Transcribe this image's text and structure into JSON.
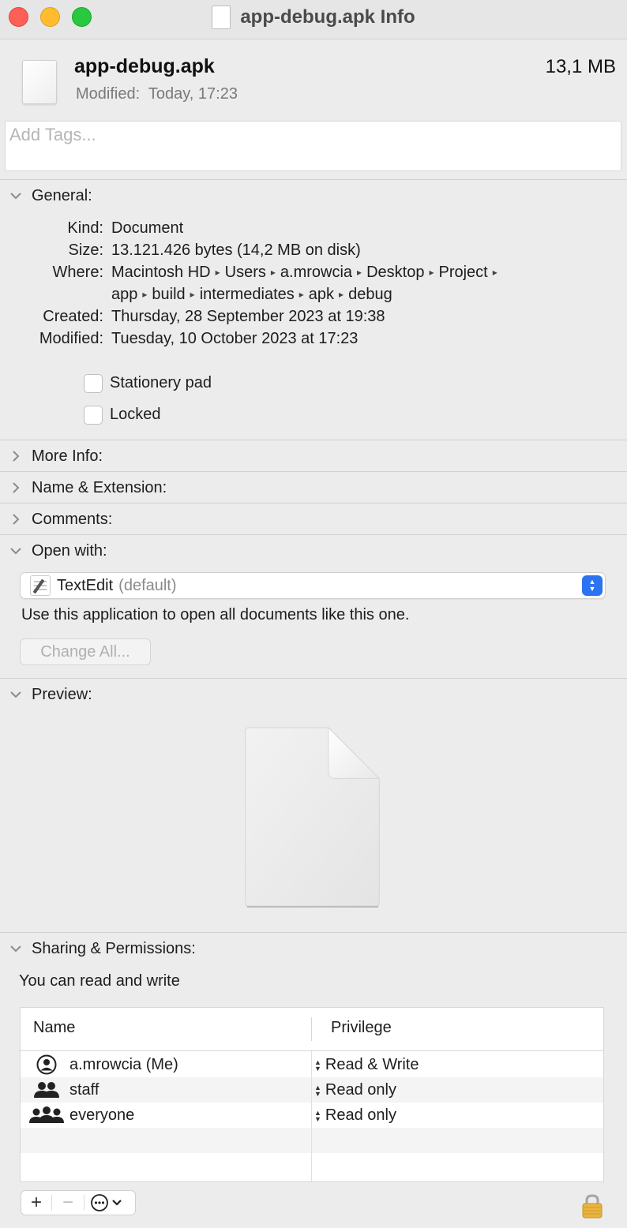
{
  "window": {
    "title": "app-debug.apk Info"
  },
  "header": {
    "file_name": "app-debug.apk",
    "file_size": "13,1 MB",
    "modified": "Modified:  Today, 17:23",
    "tags_placeholder": "Add Tags..."
  },
  "general": {
    "title": "General:",
    "kind_label": "Kind:",
    "kind_value": "Document",
    "size_label": "Size:",
    "size_value": "13.121.426 bytes (14,2 MB on disk)",
    "where_label": "Where:",
    "where_path_line1": [
      "Macintosh HD",
      "Users",
      "a.mrowcia",
      "Desktop",
      "Project"
    ],
    "where_path_line2": [
      "app",
      "build",
      "intermediates",
      "apk",
      "debug"
    ],
    "created_label": "Created:",
    "created_value": "Thursday, 28 September 2023 at 19:38",
    "modified_label": "Modified:",
    "modified_value": "Tuesday, 10 October 2023 at 17:23",
    "stationery_label": "Stationery pad",
    "locked_label": "Locked"
  },
  "sections": {
    "more_info": "More Info:",
    "name_extension": "Name & Extension:",
    "comments": "Comments:",
    "open_with": "Open with:",
    "preview": "Preview:",
    "sharing": "Sharing & Permissions:"
  },
  "open_with": {
    "app": "TextEdit",
    "default_suffix": "(default)",
    "description": "Use this application to open all documents like this one.",
    "change_all": "Change All..."
  },
  "sharing": {
    "summary": "You can read and write",
    "col_name": "Name",
    "col_privilege": "Privilege",
    "rows": [
      {
        "name": "a.mrowcia (Me)",
        "privilege": "Read & Write",
        "icon": "user-icon"
      },
      {
        "name": "staff",
        "privilege": "Read only",
        "icon": "group-icon"
      },
      {
        "name": "everyone",
        "privilege": "Read only",
        "icon": "everyone-icon"
      }
    ]
  },
  "toolbar": {
    "add": "+",
    "remove": "−"
  },
  "colors": {
    "accent": "#2b73f0",
    "close": "#fe5f57",
    "minimize": "#febc2e",
    "zoom": "#28c840"
  }
}
